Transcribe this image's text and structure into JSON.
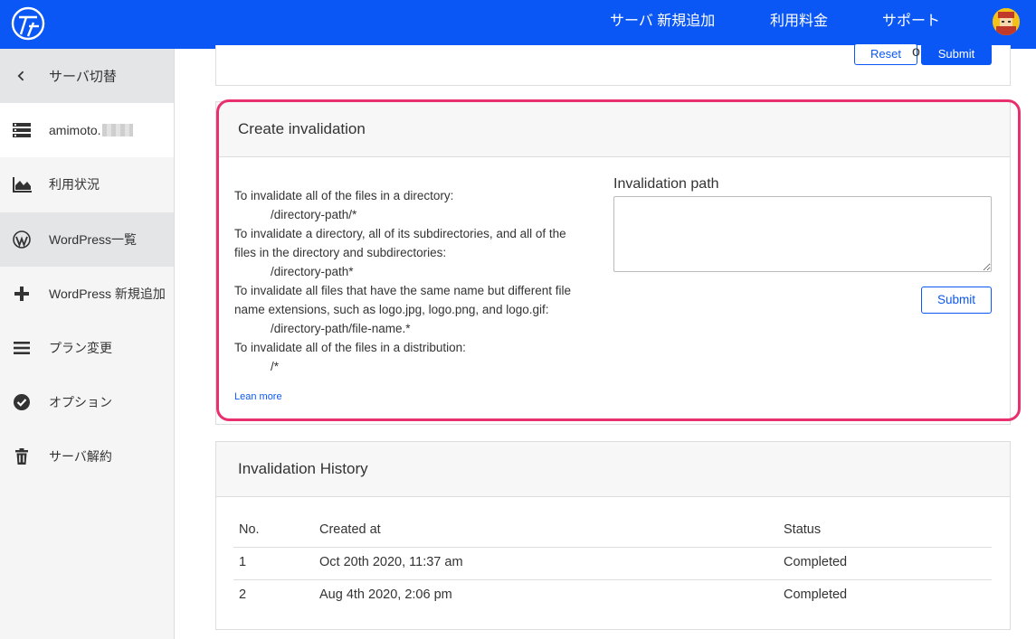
{
  "topbar": {
    "logo_icon": "service-logo-icon",
    "nav": [
      "サーバ 新規追加",
      "利用料金",
      "サポート"
    ],
    "avatar_icon": "user-avatar-icon",
    "bg_color": "#0b57f5"
  },
  "sidebar": {
    "back_label": "サーバ切替",
    "server_name": "amimoto.",
    "items": [
      {
        "label": "利用状況",
        "icon": "chart-area-icon"
      },
      {
        "label": "WordPress一覧",
        "icon": "wordpress-icon"
      },
      {
        "label": "WordPress 新規追加",
        "icon": "plus-icon"
      },
      {
        "label": "プラン変更",
        "icon": "menu-lines-icon"
      },
      {
        "label": "オプション",
        "icon": "check-circle-icon"
      },
      {
        "label": "サーバ解約",
        "icon": "trash-icon"
      }
    ]
  },
  "top_form": {
    "reset_label": "Reset",
    "or_text": "or",
    "submit_label": "Submit"
  },
  "create": {
    "title": "Create invalidation",
    "lines": [
      "To invalidate all of the files in a directory:",
      "/directory-path/*",
      "To invalidate a directory, all of its subdirectories, and all of the",
      "files in the directory and subdirectories:",
      "/directory-path*",
      "To invalidate all files that have the same name but different file",
      "name extensions, such as logo.jpg, logo.png, and logo.gif:",
      "/directory-path/file-name.*",
      "To invalidate all of the files in a distribution:",
      "/*"
    ],
    "learn_more": "Lean more",
    "path_label": "Invalidation path",
    "path_value": "",
    "submit_label": "Submit",
    "highlight_color": "#e8306e"
  },
  "history": {
    "title": "Invalidation History",
    "columns": [
      "No.",
      "Created at",
      "Status"
    ],
    "rows": [
      [
        "1",
        "Oct 20th 2020, 11:37 am",
        "Completed"
      ],
      [
        "2",
        "Aug 4th 2020, 2:06 pm",
        "Completed"
      ]
    ]
  }
}
